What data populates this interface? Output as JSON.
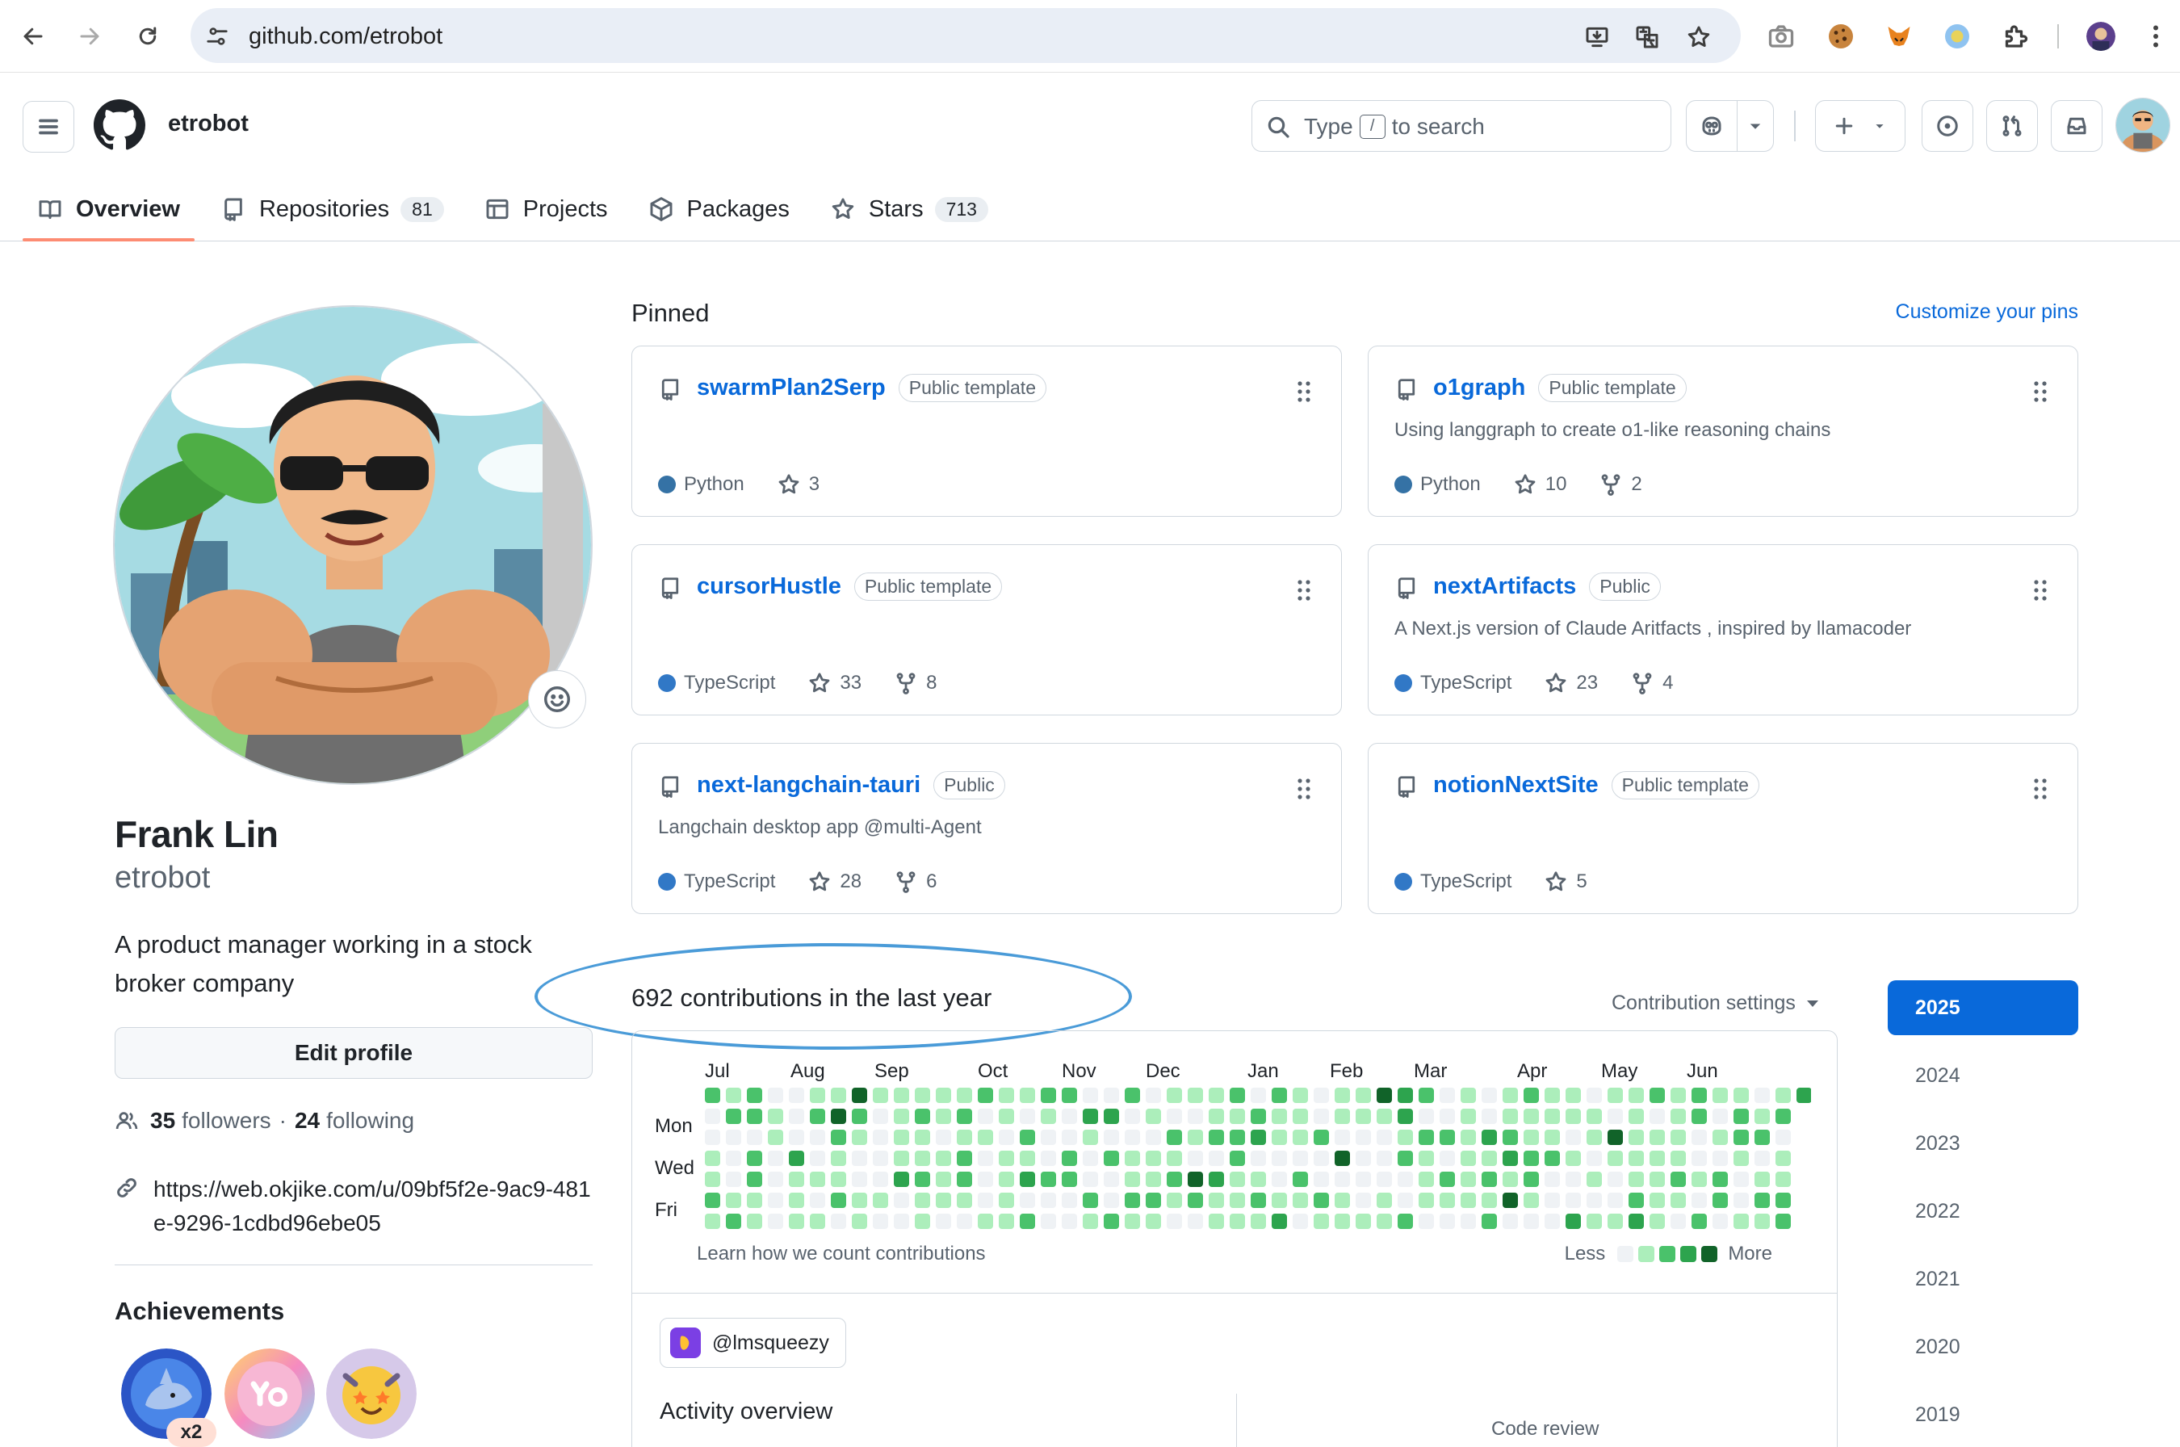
{
  "browser": {
    "url": "github.com/etrobot"
  },
  "header": {
    "username": "etrobot",
    "search_prefix": "Type",
    "search_key": "/",
    "search_suffix": "to search"
  },
  "tabs": [
    {
      "label": "Overview"
    },
    {
      "label": "Repositories",
      "count": "81"
    },
    {
      "label": "Projects"
    },
    {
      "label": "Packages"
    },
    {
      "label": "Stars",
      "count": "713"
    }
  ],
  "profile": {
    "full_name": "Frank Lin",
    "login": "etrobot",
    "bio": "A product manager working in a stock broker company",
    "edit_label": "Edit profile",
    "followers_count": "35",
    "followers_label": "followers",
    "separator": "·",
    "following_count": "24",
    "following_label": "following",
    "link": "https://web.okjike.com/u/09bf5f2e-9ac9-481e-9296-1cdbd96ebe05",
    "achievements_title": "Achievements",
    "achievement_multiplier": "x2"
  },
  "pinned": {
    "title": "Pinned",
    "customize_label": "Customize your pins",
    "repos": [
      {
        "name": "swarmPlan2Serp",
        "visibility": "Public template",
        "description": "",
        "language": "Python",
        "lang_color": "#3572A5",
        "stars": "3",
        "forks": ""
      },
      {
        "name": "o1graph",
        "visibility": "Public template",
        "description": "Using langgraph to create o1-like reasoning chains",
        "language": "Python",
        "lang_color": "#3572A5",
        "stars": "10",
        "forks": "2"
      },
      {
        "name": "cursorHustle",
        "visibility": "Public template",
        "description": "",
        "language": "TypeScript",
        "lang_color": "#3178c6",
        "stars": "33",
        "forks": "8"
      },
      {
        "name": "nextArtifacts",
        "visibility": "Public",
        "description": "A Next.js version of Claude Aritfacts , inspired by llamacoder",
        "language": "TypeScript",
        "lang_color": "#3178c6",
        "stars": "23",
        "forks": "4"
      },
      {
        "name": "next-langchain-tauri",
        "visibility": "Public",
        "description": "Langchain desktop app @multi-Agent",
        "language": "TypeScript",
        "lang_color": "#3178c6",
        "stars": "28",
        "forks": "6"
      },
      {
        "name": "notionNextSite",
        "visibility": "Public template",
        "description": "",
        "language": "TypeScript",
        "lang_color": "#3178c6",
        "stars": "5",
        "forks": ""
      }
    ]
  },
  "contributions": {
    "title": "692 contributions in the last year",
    "settings_label": "Contribution settings",
    "months": [
      "Jul",
      "Aug",
      "Sep",
      "Oct",
      "Nov",
      "Dec",
      "Jan",
      "Feb",
      "Mar",
      "Apr",
      "May",
      "Jun"
    ],
    "weekdays": [
      "Mon",
      "Wed",
      "Fri"
    ],
    "learn_label": "Learn how we count contributions",
    "legend_less": "Less",
    "legend_more": "More",
    "level_colors": [
      "#eff2f5",
      "#aceebb",
      "#4ac26b",
      "#2da44e",
      "#116329"
    ],
    "weeks": 53
  },
  "years": [
    "2025",
    "2024",
    "2023",
    "2022",
    "2021",
    "2020",
    "2019"
  ],
  "selected_year": "2025",
  "activity": {
    "org": "@lmsqueezy",
    "title": "Activity overview",
    "code_review": "Code review"
  }
}
